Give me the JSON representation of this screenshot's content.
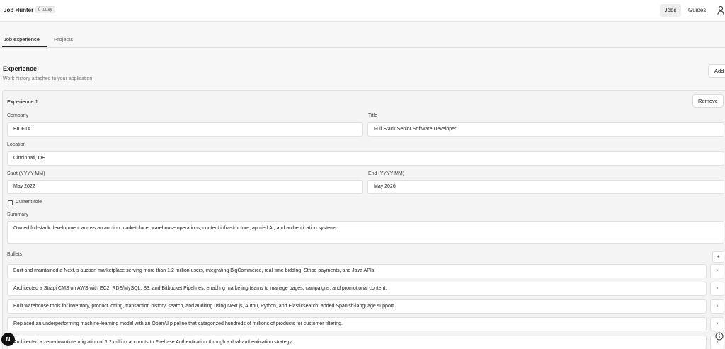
{
  "header": {
    "app_title": "Job Hunter",
    "today_badge": "0 today",
    "nav_jobs": "Jobs",
    "nav_guides": "Guides",
    "user_icon": "user-icon"
  },
  "tabs": [
    {
      "label": "Job experience",
      "active": true
    },
    {
      "label": "Projects",
      "active": false
    }
  ],
  "section": {
    "title": "Experience",
    "subtitle": "Work history attached to your application.",
    "add_label": "Add"
  },
  "experience": {
    "title": "Experience 1",
    "remove_label": "Remove",
    "company_label": "Company",
    "company_value": "BIDFTA",
    "title_label": "Title",
    "title_value": "Full Stack Senior Software Developer",
    "location_label": "Location",
    "location_value": "Cincinnati, OH",
    "start_label": "Start (YYYY-MM)",
    "start_value": "May 2022",
    "end_label": "End (YYYY-MM)",
    "end_value": "May 2026",
    "current_role_label": "Current role",
    "current_role_checked": false,
    "summary_label": "Summary",
    "summary_value": "Owned full-stack development across an auction marketplace, warehouse operations, content infrastructure, applied AI, and authentication systems.",
    "bullets_label": "Bullets",
    "add_bullet_symbol": "+",
    "remove_bullet_symbol": "×",
    "bullets": [
      "Built and maintained a Next.js auction marketplace serving more than 1.2 million users, integrating BigCommerce, real-time bidding, Stripe payments, and Java APIs.",
      "Architected a Strapi CMS on AWS with EC2, RDS/MySQL, S3, and Bitbucket Pipelines, enabling marketing teams to manage pages, campaigns, and promotional content.",
      "Built warehouse tools for inventory, product lotting, transaction history, search, and auditing using Next.js, Auth0, Python, and Elasticsearch; added Spanish-language support.",
      "Replaced an underperforming machine-learning model with an OpenAI pipeline that categorized hundreds of millions of products for customer filtering.",
      "Architected a zero-downtime migration of 1.2 million accounts to Firebase Authentication through a dual-authentication strategy."
    ]
  },
  "floating": {
    "n_badge": "N",
    "info_icon": "info-icon"
  }
}
